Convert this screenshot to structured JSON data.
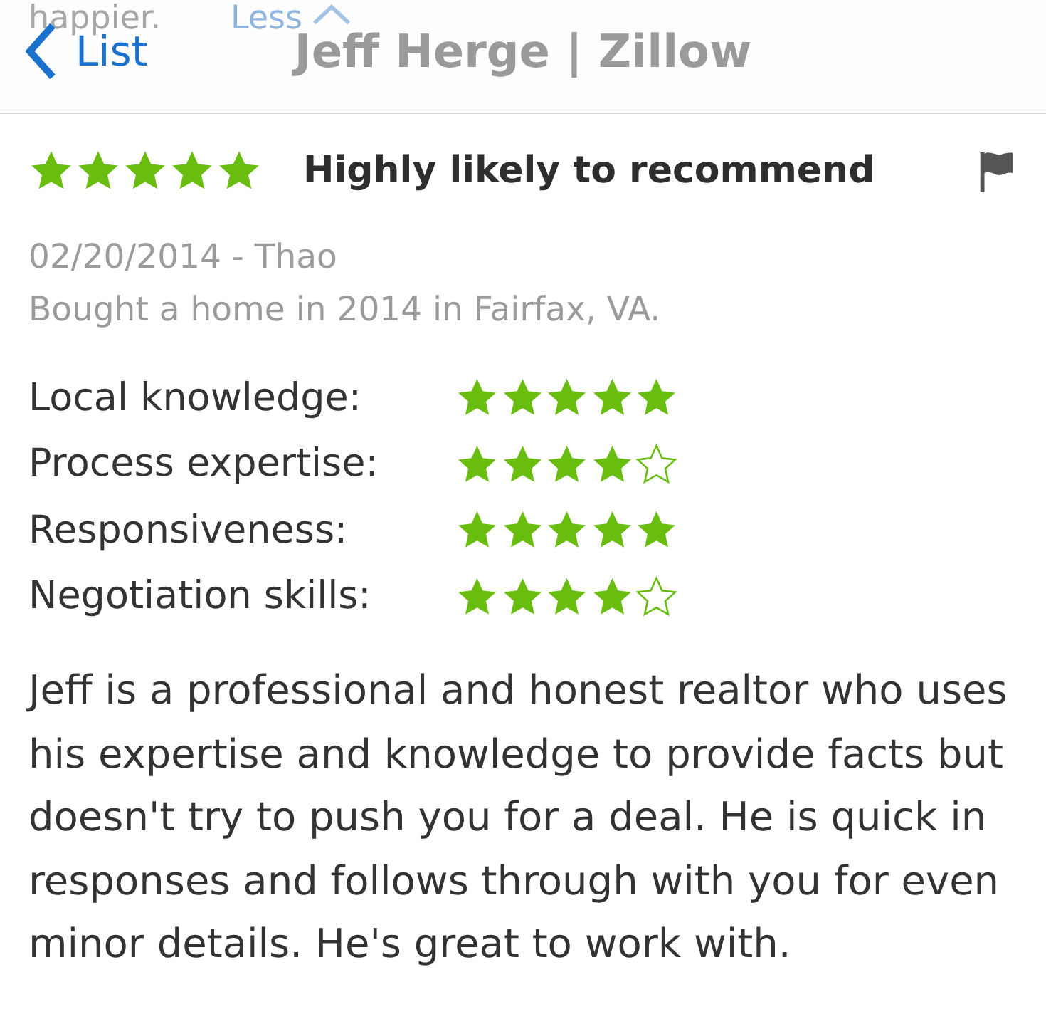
{
  "behind_header": {
    "text": "happier.",
    "link": "Less"
  },
  "header": {
    "back": "List",
    "title": "Jeff Herge | Zillow"
  },
  "review": {
    "stars": 5,
    "headline": "Highly likely to recommend",
    "meta": "02/20/2014 - Thao",
    "purchase": "Bought a home in 2014 in Fairfax, VA.",
    "ratings": [
      {
        "label": "Local knowledge:",
        "stars": 5
      },
      {
        "label": "Process expertise:",
        "stars": 4
      },
      {
        "label": "Responsiveness:",
        "stars": 5
      },
      {
        "label": "Negotiation skills:",
        "stars": 4
      }
    ],
    "body": "Jeff is a professional and honest realtor who uses his expertise and knowledge to provide facts but doesn't try to push you for a deal. He is quick in responses and follows through with you for even minor details. He's great to work with."
  }
}
